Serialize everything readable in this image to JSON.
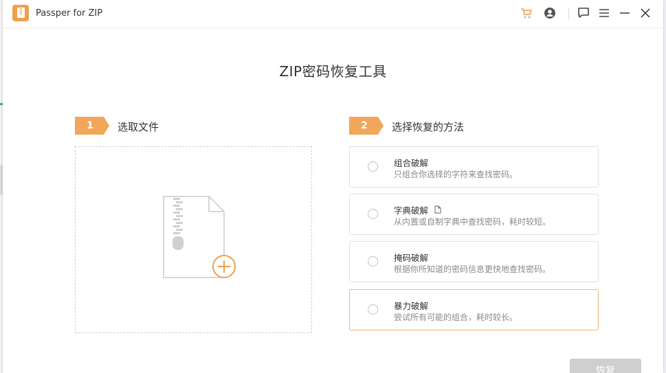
{
  "app": {
    "title": "Passper for ZIP"
  },
  "titlebar": {
    "icons": [
      "cart-icon",
      "user-icon",
      "feedback-icon",
      "menu-icon",
      "minimize-icon",
      "close-icon"
    ],
    "accent_color": "#ef9f4a"
  },
  "main": {
    "title": "ZIP密码恢复工具"
  },
  "step1": {
    "number": "1",
    "label": "选取文件"
  },
  "step2": {
    "number": "2",
    "label": "选择恢复的方法"
  },
  "methods": [
    {
      "title": "组合破解",
      "desc": "只组合你选择的字符来查找密码。",
      "selected": false
    },
    {
      "title": "字典破解",
      "desc": "从内置或自制字典中查找密码，耗时较短。",
      "selected": false
    },
    {
      "title": "掩码破解",
      "desc": "根据你所知道的密码信息更快地查找密码。",
      "selected": false
    },
    {
      "title": "暴力破解",
      "desc": "尝试所有可能的组合，耗时较长。",
      "selected": true
    }
  ],
  "actions": {
    "recover_label": "恢复"
  },
  "colors": {
    "accent": "#f2a65a",
    "selected_border": "#f0b178",
    "button_disabled": "#cfcfcf"
  }
}
